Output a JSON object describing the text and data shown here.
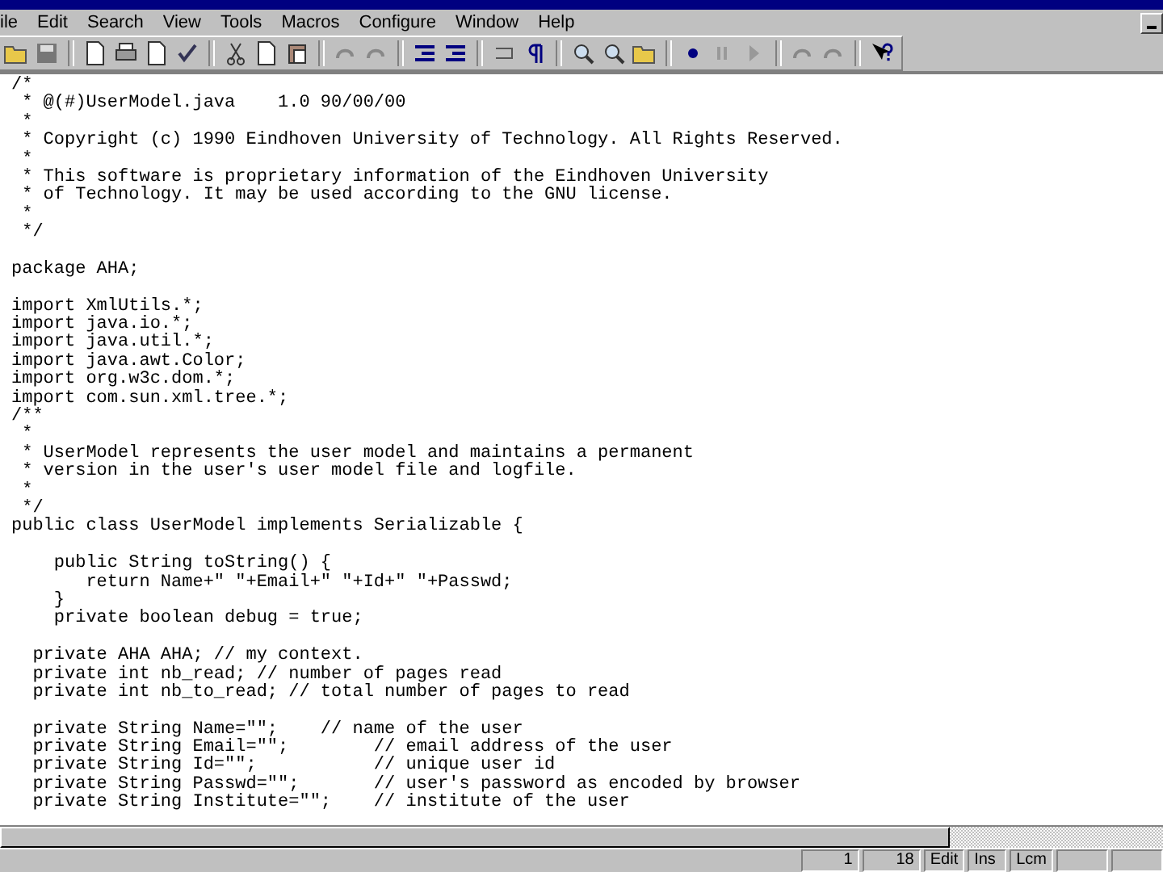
{
  "menu_bar": {
    "items": [
      "ile",
      "Edit",
      "Search",
      "View",
      "Tools",
      "Macros",
      "Configure",
      "Window",
      "Help"
    ]
  },
  "editor": {
    "lines": [
      {
        "text": "/*"
      },
      {
        "text": " * @(#)UserModel.java    1.0 90/00/00"
      },
      {
        "text": " *"
      },
      {
        "text": " * Copyright (c) 1990 Eindhoven University of Technology. All Rights Reserved."
      },
      {
        "text": " *"
      },
      {
        "text": " * This software is proprietary information of the Eindhoven University"
      },
      {
        "text": " * of Technology. It may be used according to the GNU license."
      },
      {
        "text": " *"
      },
      {
        "text": " */"
      },
      {
        "text": "package AHA;",
        "gap_before": true
      },
      {
        "text": "import XmlUtils.*;",
        "gap_before": true
      },
      {
        "text": "import java.io.*;"
      },
      {
        "text": "import java.util.*;"
      },
      {
        "text": "import java.awt.Color;"
      },
      {
        "text": "import org.w3c.dom.*;"
      },
      {
        "text": "import com.sun.xml.tree.*;"
      },
      {
        "text": "/**"
      },
      {
        "text": " *"
      },
      {
        "text": " * UserModel represents the user model and maintains a permanent"
      },
      {
        "text": " * version in the user's user model file and logfile."
      },
      {
        "text": " *"
      },
      {
        "text": " */"
      },
      {
        "text": "public class UserModel implements Serializable {"
      },
      {
        "text": "    public String toString() {",
        "gap_before": true
      },
      {
        "text": "       return Name+\" \"+Email+\" \"+Id+\" \"+Passwd;"
      },
      {
        "text": "    }"
      },
      {
        "text": "    private boolean debug = true;"
      },
      {
        "text": "  private AHA AHA; // my context.",
        "gap_before": true
      },
      {
        "text": "  private int nb_read; // number of pages read"
      },
      {
        "text": "  private int nb_to_read; // total number of pages to read"
      },
      {
        "text": "  private String Name=\"\";    // name of the user",
        "gap_before": true
      },
      {
        "text": "  private String Email=\"\";        // email address of the user"
      },
      {
        "text": "  private String Id=\"\";           // unique user id"
      },
      {
        "text": "  private String Passwd=\"\";       // user's password as encoded by browser"
      },
      {
        "text": "  private String Institute=\"\";    // institute of the user"
      }
    ]
  },
  "status_bar": {
    "cells": [
      "1",
      "18",
      "Edit",
      "Ins",
      "Lcm"
    ]
  }
}
